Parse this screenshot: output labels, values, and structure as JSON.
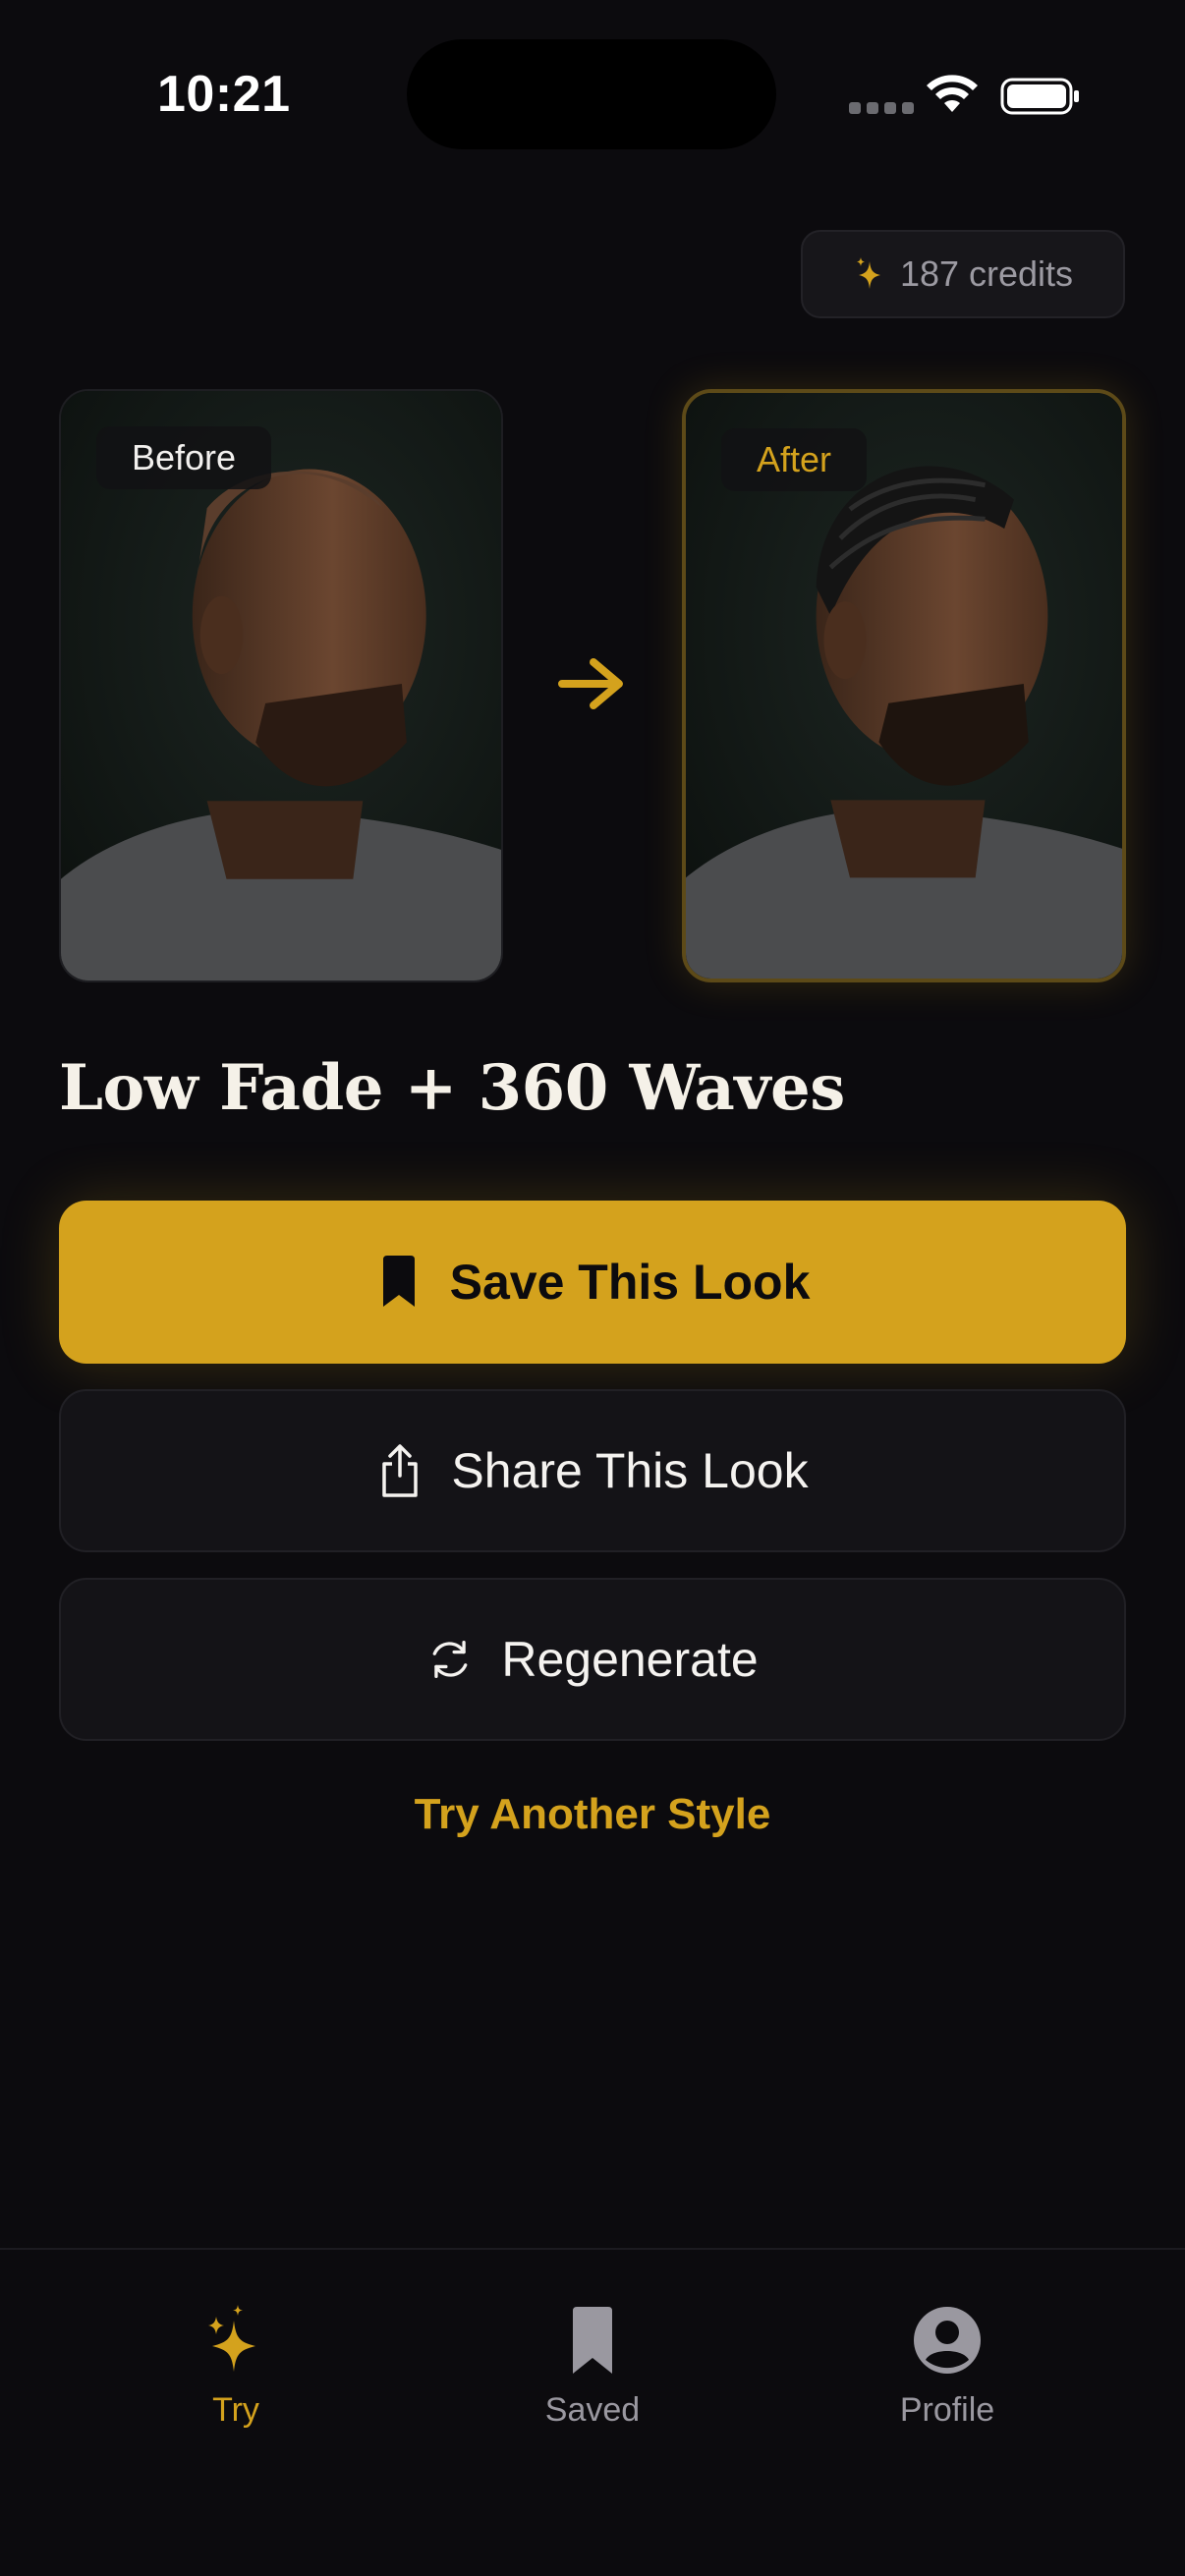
{
  "status_bar": {
    "time": "10:21"
  },
  "credits": {
    "label": "187 credits",
    "icon": "sparkle-icon"
  },
  "comparison": {
    "before_label": "Before",
    "after_label": "After",
    "arrow_icon": "arrow-right-icon"
  },
  "style_name": "Low Fade + 360 Waves",
  "actions": {
    "save_label": "Save This Look",
    "share_label": "Share This Look",
    "regenerate_label": "Regenerate",
    "try_another_label": "Try Another Style"
  },
  "tabbar": {
    "tabs": [
      {
        "label": "Try",
        "icon": "sparkles-icon",
        "active": true
      },
      {
        "label": "Saved",
        "icon": "bookmark-icon",
        "active": false
      },
      {
        "label": "Profile",
        "icon": "person-circle-icon",
        "active": false
      }
    ]
  },
  "colors": {
    "background": "#0c0b0e",
    "accent": "#d4a21d",
    "card": "#141317",
    "muted_text": "#9a98a0"
  }
}
